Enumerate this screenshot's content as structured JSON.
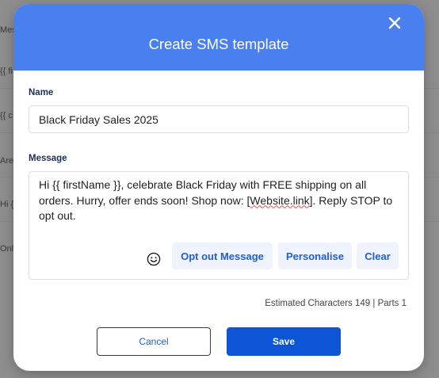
{
  "background": {
    "header_label": "Mes",
    "rows": [
      "{{ fi",
      "{{ c",
      "Are",
      "Hi {",
      "Onl"
    ]
  },
  "modal": {
    "title": "Create SMS template",
    "close_icon": "close-icon",
    "name": {
      "label": "Name",
      "value": "Black Friday Sales 2025"
    },
    "message": {
      "label": "Message",
      "text_before": "Hi {{ firstName }}, celebrate Black Friday with FREE shipping on all orders. Hurry, offer ends soon! Shop now: [",
      "text_link": "Website.link",
      "text_after": "]. Reply STOP to opt out."
    },
    "emoji_icon": "emoji-smile-icon",
    "actions": {
      "opt_out": "Opt out Message",
      "personalise": "Personalise",
      "clear": "Clear"
    },
    "estimate": "Estimated Characters 149 | Parts 1",
    "buttons": {
      "cancel": "Cancel",
      "save": "Save"
    }
  },
  "colors": {
    "header": "#4a7ff0",
    "primary": "#0c55d6",
    "action_bg": "#eef3fd",
    "overlay": "#8e8e8e"
  }
}
